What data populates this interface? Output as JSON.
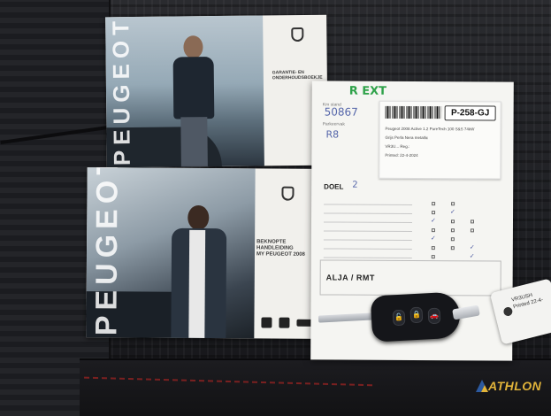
{
  "scene": {
    "description_alt": ""
  },
  "booklet_top": {
    "brand_vertical": "PEUGEOT",
    "cover_title_lines": [
      "GARANTIE- EN",
      "ONDERHOUDSBOEKJE"
    ]
  },
  "booklet_bottom": {
    "brand_vertical": "PEUGEOT",
    "cover_title_lines": [
      "BEKNOPTE HANDLEIDING",
      "MY PEUGEOT 2008"
    ]
  },
  "sheet": {
    "handwriting_top": "R   EXT",
    "km_stand_label": "Km stand",
    "km_stand_value": "50867",
    "parkeervak_label": "Parkeervak",
    "parkeervak_value": "R8",
    "plate": "P-258-GJ",
    "sticker_lines": [
      "Peugeot 2008 Active 1.2 PureTech 100 S&S 74kW",
      "Grijs Perla Nera metallic",
      "VR3U... Reg.:",
      "Printed: 22-4-2024"
    ],
    "doel_label": "DOEL",
    "doel_value": "2",
    "ref_label": "ALJA / RMT"
  },
  "key_buttons": [
    "🔓",
    "🔒",
    "🚗"
  ],
  "tag": {
    "lines": [
      "VR3USH",
      "Printed 22-4-"
    ]
  },
  "watermark": {
    "text": "ATHLON",
    "color": "#e2b43a"
  }
}
